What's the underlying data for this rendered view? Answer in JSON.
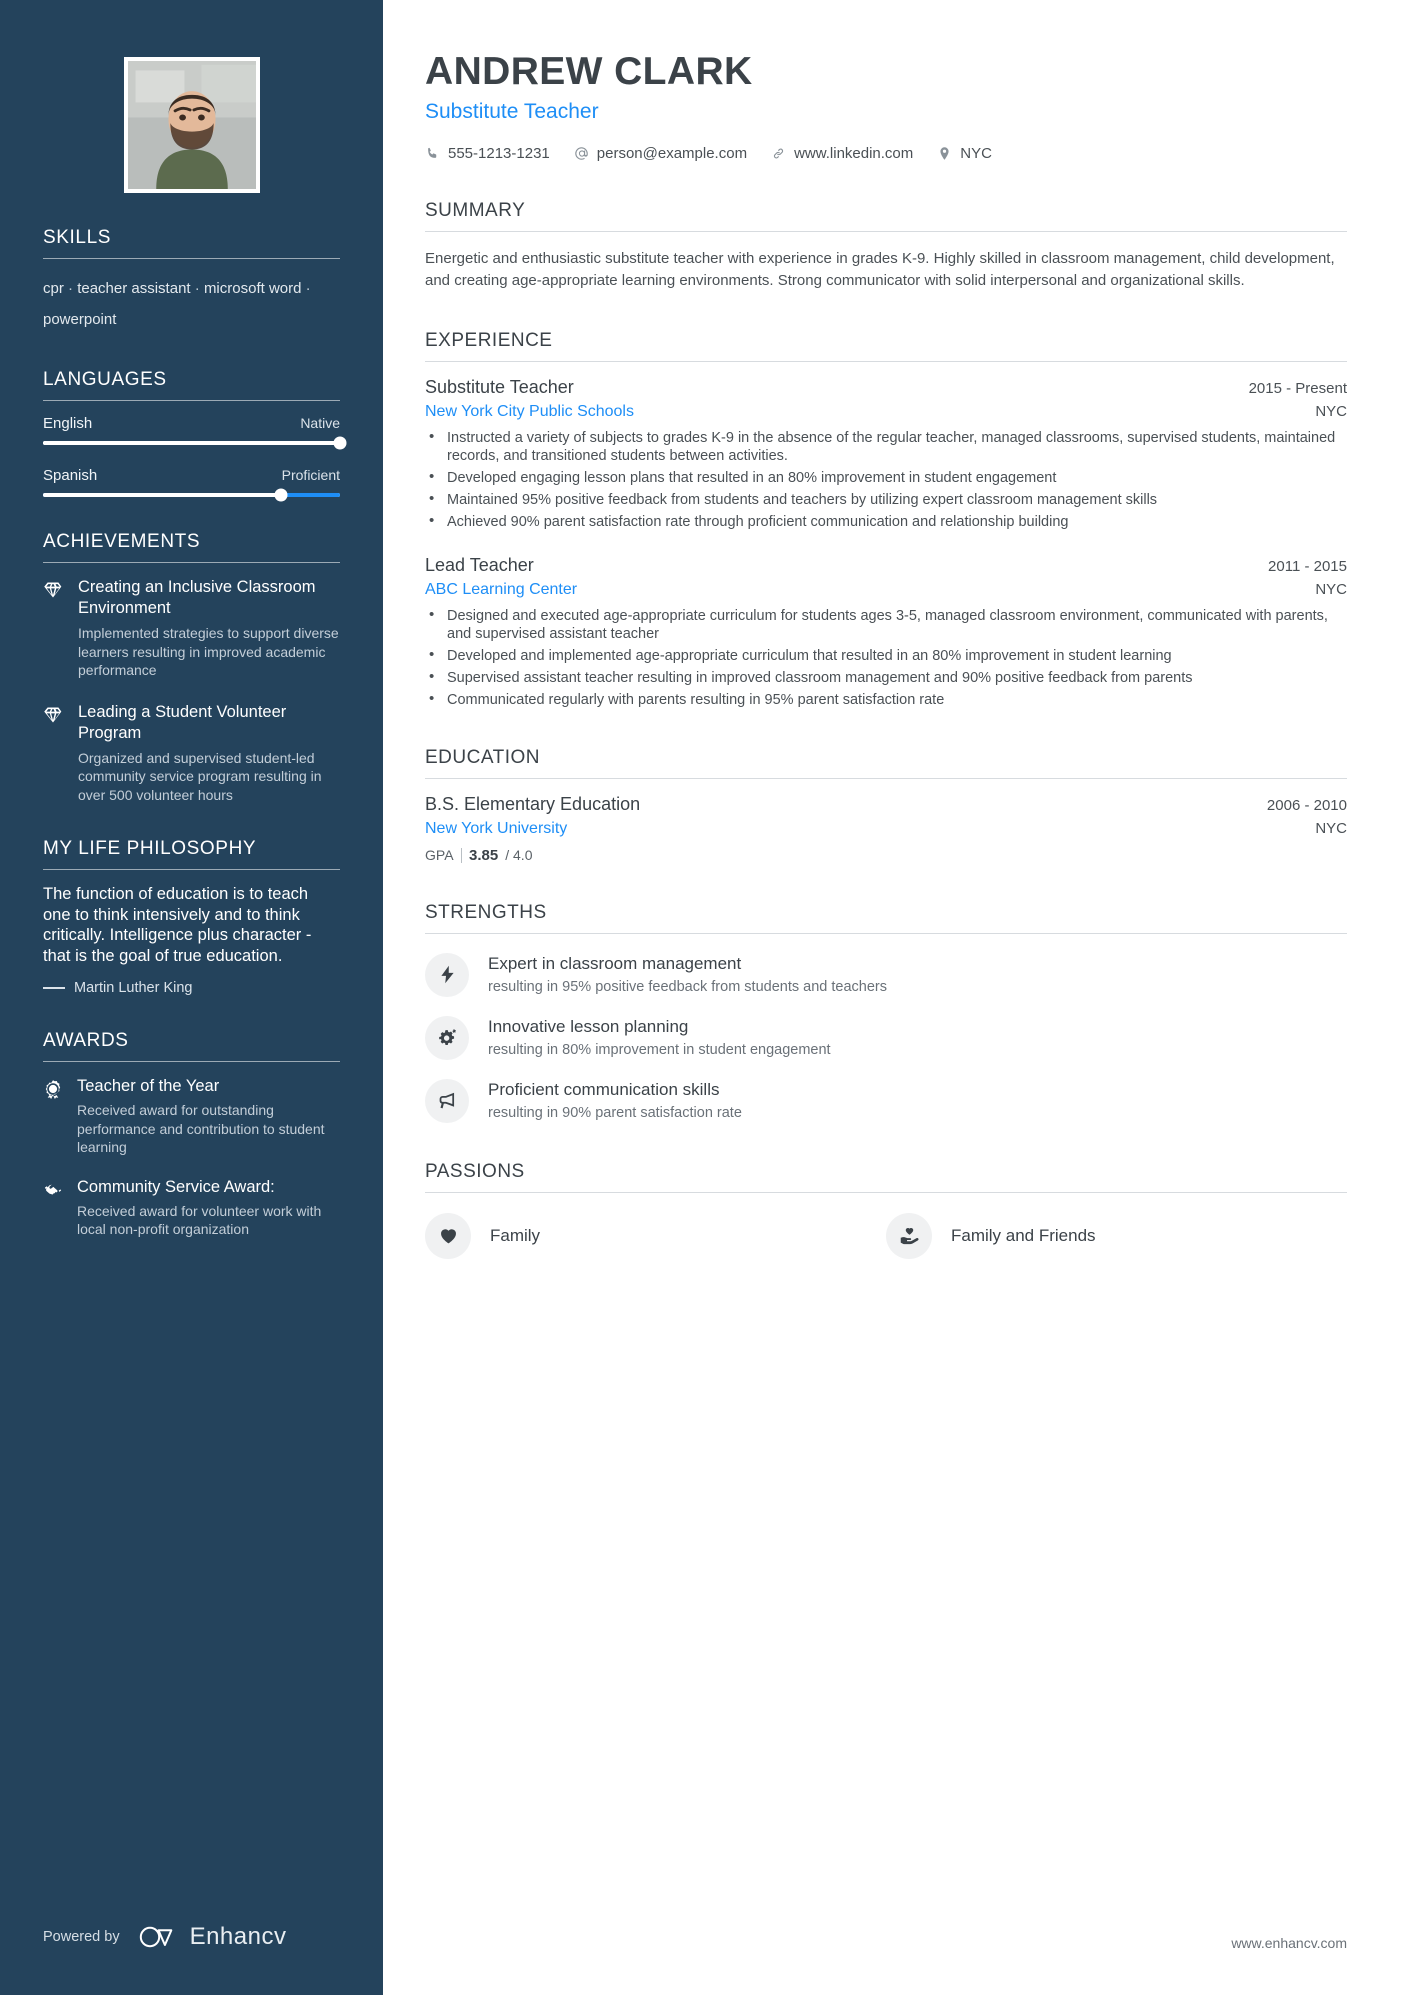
{
  "sidebar": {
    "avatar_alt": "profile-photo",
    "skills": {
      "heading": "SKILLS",
      "items": [
        "cpr",
        "teacher assistant",
        "microsoft word",
        "powerpoint"
      ],
      "separator": "·"
    },
    "languages": {
      "heading": "LANGUAGES",
      "items": [
        {
          "name": "English",
          "level": "Native",
          "percent": 100
        },
        {
          "name": "Spanish",
          "level": "Proficient",
          "percent": 80
        }
      ]
    },
    "achievements": {
      "heading": "ACHIEVEMENTS",
      "items": [
        {
          "icon": "diamond-icon",
          "title": "Creating an Inclusive Classroom Environment",
          "description": "Implemented strategies to support diverse learners resulting in improved academic performance"
        },
        {
          "icon": "diamond-icon",
          "title": "Leading a Student Volunteer Program",
          "description": "Organized and supervised student-led community service program resulting in over 500 volunteer hours"
        }
      ]
    },
    "philosophy": {
      "heading": "MY LIFE PHILOSOPHY",
      "quote": "The function of education is to teach one to think intensively and to think critically. Intelligence plus character - that is the goal of true education.",
      "author": "Martin Luther King"
    },
    "awards": {
      "heading": "AWARDS",
      "items": [
        {
          "icon": "award-ribbon-icon",
          "title": "Teacher of the Year",
          "description": "Received award for outstanding performance and contribution to student learning"
        },
        {
          "icon": "handshake-icon",
          "title": "Community Service Award:",
          "description": "Received award for volunteer work with local non-profit organization"
        }
      ]
    },
    "footer": {
      "powered_by": "Powered by",
      "brand": "Enhancv",
      "logo_icon": "enhancv-logo-icon"
    }
  },
  "header": {
    "name": "ANDREW CLARK",
    "role": "Substitute Teacher",
    "contacts": [
      {
        "icon": "phone-icon",
        "value": "555-1213-1231"
      },
      {
        "icon": "email-icon",
        "value": "person@example.com"
      },
      {
        "icon": "link-icon",
        "value": "www.linkedin.com"
      },
      {
        "icon": "location-pin-icon",
        "value": "NYC"
      }
    ]
  },
  "main": {
    "summary": {
      "heading": "SUMMARY",
      "text": "Energetic and enthusiastic substitute teacher with experience in grades K-9. Highly skilled in classroom management, child development, and creating age-appropriate learning environments. Strong communicator with solid interpersonal and organizational skills."
    },
    "experience": {
      "heading": "EXPERIENCE",
      "entries": [
        {
          "title": "Substitute Teacher",
          "date": "2015 - Present",
          "organization": "New York City Public Schools",
          "location": "NYC",
          "bullets": [
            "Instructed a variety of subjects to grades K-9 in the absence of the regular teacher, managed classrooms, supervised students, maintained records, and transitioned students between activities.",
            "Developed engaging lesson plans that resulted in an 80% improvement in student engagement",
            "Maintained 95% positive feedback from students and teachers by utilizing expert classroom management skills",
            "Achieved 90% parent satisfaction rate through proficient communication and relationship building"
          ]
        },
        {
          "title": "Lead Teacher",
          "date": "2011 - 2015",
          "organization": "ABC Learning Center",
          "location": "NYC",
          "bullets": [
            "Designed and executed age-appropriate curriculum for students ages 3-5, managed classroom environment, communicated with parents, and supervised assistant teacher",
            "Developed and implemented age-appropriate curriculum that resulted in an 80% improvement in student learning",
            "Supervised assistant teacher resulting in improved classroom management and 90% positive feedback from parents",
            "Communicated regularly with parents resulting in 95% parent satisfaction rate"
          ]
        }
      ]
    },
    "education": {
      "heading": "EDUCATION",
      "entries": [
        {
          "title": "B.S. Elementary Education",
          "date": "2006 - 2010",
          "organization": "New York University",
          "location": "NYC",
          "gpa_label": "GPA",
          "gpa_value": "3.85",
          "gpa_scale": "/ 4.0"
        }
      ]
    },
    "strengths": {
      "heading": "STRENGTHS",
      "items": [
        {
          "icon": "lightning-bolt-icon",
          "title": "Expert in classroom management",
          "description": "resulting in 95% positive feedback from students and teachers"
        },
        {
          "icon": "gears-icon",
          "title": "Innovative lesson planning",
          "description": "resulting in 80% improvement in student engagement"
        },
        {
          "icon": "megaphone-icon",
          "title": "Proficient communication skills",
          "description": "resulting in 90% parent satisfaction rate"
        }
      ]
    },
    "passions": {
      "heading": "PASSIONS",
      "items": [
        {
          "icon": "heart-icon",
          "label": "Family"
        },
        {
          "icon": "hand-holding-heart-icon",
          "label": "Family and Friends"
        }
      ]
    },
    "footer_url": "www.enhancv.com"
  },
  "colors": {
    "sidebar_bg": "#24435C",
    "accent_blue": "#1E8EF6",
    "text_dark": "#3b4248",
    "text_body": "#4a5055"
  }
}
